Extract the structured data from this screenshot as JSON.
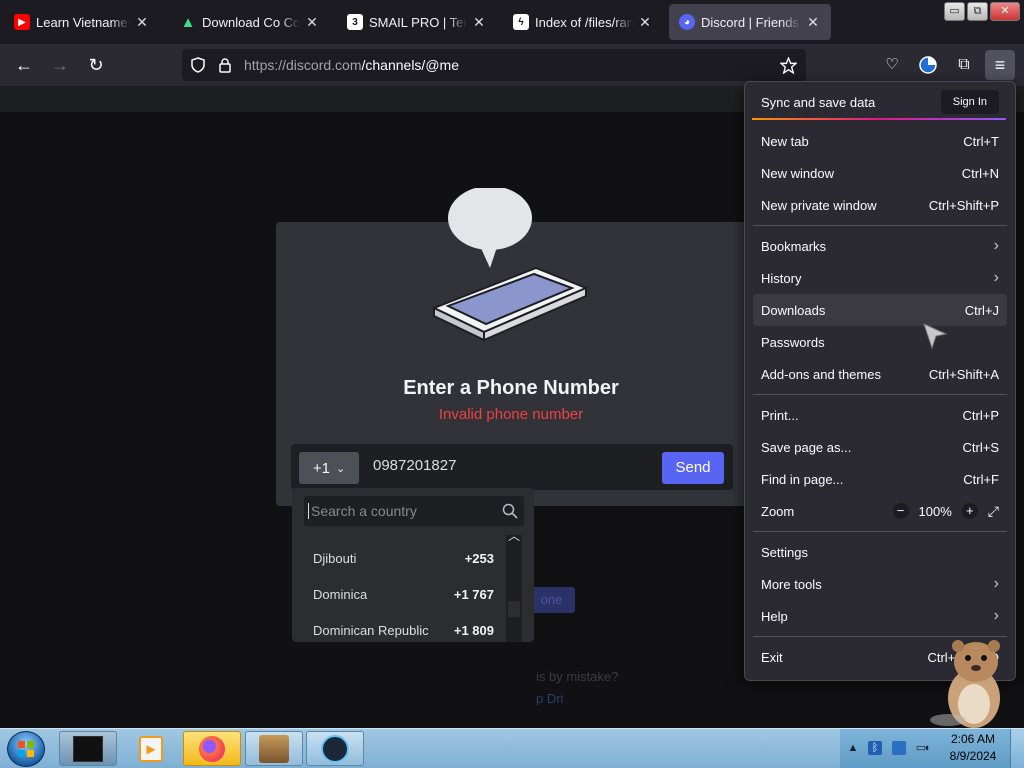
{
  "browser": {
    "tabs": [
      {
        "title": "Learn Vietnamese through",
        "favicon": "youtube-icon",
        "color": "#ff0000"
      },
      {
        "title": "Download Co Co: Magic",
        "favicon": "apkcombo-icon",
        "color": "#3ddc84"
      },
      {
        "title": "SMAIL PRO | Temp mail",
        "favicon": "smail-icon",
        "color": "#ffffff"
      },
      {
        "title": "Index of /files/random",
        "favicon": "lightning-icon",
        "color": "#ffffff"
      },
      {
        "title": "Discord | Friends",
        "favicon": "discord-icon",
        "color": "#5865f2"
      }
    ],
    "active_tab": 4,
    "url_host": "https://discord.com",
    "url_path": "/channels/@me",
    "window_buttons": {
      "minimize": "▭",
      "restore": "⧉",
      "close": "✕"
    }
  },
  "discord": {
    "modal_title": "Enter a Phone Number",
    "error": "Invalid phone number",
    "country_code": "+1",
    "phone_value": "0987201827",
    "send_label": "Send",
    "country_search_placeholder": "Search a country",
    "countries": [
      {
        "name": "Djibouti",
        "code": "+253"
      },
      {
        "name": "Dominica",
        "code": "+1 767"
      },
      {
        "name": "Dominican Republic",
        "code": "+1 809"
      }
    ]
  },
  "menu": {
    "sync_label": "Sync and save data",
    "signin_label": "Sign In",
    "items": [
      {
        "label": "New tab",
        "shortcut": "Ctrl+T"
      },
      {
        "label": "New window",
        "shortcut": "Ctrl+N"
      },
      {
        "label": "New private window",
        "shortcut": "Ctrl+Shift+P"
      },
      {
        "label": "Bookmarks",
        "shortcut": ""
      },
      {
        "label": "History",
        "shortcut": ""
      },
      {
        "label": "Downloads",
        "shortcut": "Ctrl+J"
      },
      {
        "label": "Passwords",
        "shortcut": ""
      },
      {
        "label": "Add-ons and themes",
        "shortcut": "Ctrl+Shift+A"
      },
      {
        "label": "Print...",
        "shortcut": "Ctrl+P"
      },
      {
        "label": "Save page as...",
        "shortcut": "Ctrl+S"
      },
      {
        "label": "Find in page...",
        "shortcut": "Ctrl+F"
      },
      {
        "label": "Zoom",
        "shortcut": ""
      },
      {
        "label": "Settings",
        "shortcut": ""
      },
      {
        "label": "More tools",
        "shortcut": ""
      },
      {
        "label": "Help",
        "shortcut": ""
      },
      {
        "label": "Exit",
        "shortcut": "Ctrl+Shift+Q"
      }
    ],
    "zoom_level": "100%",
    "zoom_minus": "−",
    "zoom_plus": "+"
  },
  "taskbar": {
    "time": "2:06 AM",
    "date": "8/9/2024",
    "apps": [
      "terminal-icon",
      "media-player-icon",
      "firefox-icon",
      "game-box-icon",
      "steam-icon"
    ]
  },
  "colors": {
    "discord_blurple": "#5865f2",
    "error_red": "#f23f43",
    "menu_bg": "#2b2a33"
  }
}
